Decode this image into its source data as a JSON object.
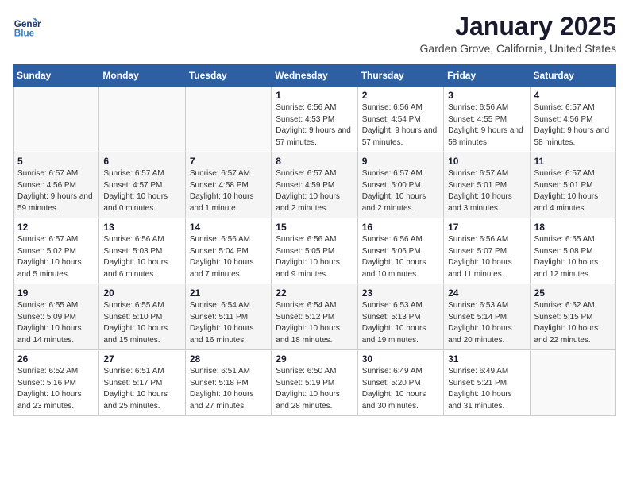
{
  "header": {
    "logo_line1": "General",
    "logo_line2": "Blue",
    "title": "January 2025",
    "subtitle": "Garden Grove, California, United States"
  },
  "weekdays": [
    "Sunday",
    "Monday",
    "Tuesday",
    "Wednesday",
    "Thursday",
    "Friday",
    "Saturday"
  ],
  "weeks": [
    [
      {
        "day": "",
        "sunrise": "",
        "sunset": "",
        "daylight": ""
      },
      {
        "day": "",
        "sunrise": "",
        "sunset": "",
        "daylight": ""
      },
      {
        "day": "",
        "sunrise": "",
        "sunset": "",
        "daylight": ""
      },
      {
        "day": "1",
        "sunrise": "Sunrise: 6:56 AM",
        "sunset": "Sunset: 4:53 PM",
        "daylight": "Daylight: 9 hours and 57 minutes."
      },
      {
        "day": "2",
        "sunrise": "Sunrise: 6:56 AM",
        "sunset": "Sunset: 4:54 PM",
        "daylight": "Daylight: 9 hours and 57 minutes."
      },
      {
        "day": "3",
        "sunrise": "Sunrise: 6:56 AM",
        "sunset": "Sunset: 4:55 PM",
        "daylight": "Daylight: 9 hours and 58 minutes."
      },
      {
        "day": "4",
        "sunrise": "Sunrise: 6:57 AM",
        "sunset": "Sunset: 4:56 PM",
        "daylight": "Daylight: 9 hours and 58 minutes."
      }
    ],
    [
      {
        "day": "5",
        "sunrise": "Sunrise: 6:57 AM",
        "sunset": "Sunset: 4:56 PM",
        "daylight": "Daylight: 9 hours and 59 minutes."
      },
      {
        "day": "6",
        "sunrise": "Sunrise: 6:57 AM",
        "sunset": "Sunset: 4:57 PM",
        "daylight": "Daylight: 10 hours and 0 minutes."
      },
      {
        "day": "7",
        "sunrise": "Sunrise: 6:57 AM",
        "sunset": "Sunset: 4:58 PM",
        "daylight": "Daylight: 10 hours and 1 minute."
      },
      {
        "day": "8",
        "sunrise": "Sunrise: 6:57 AM",
        "sunset": "Sunset: 4:59 PM",
        "daylight": "Daylight: 10 hours and 2 minutes."
      },
      {
        "day": "9",
        "sunrise": "Sunrise: 6:57 AM",
        "sunset": "Sunset: 5:00 PM",
        "daylight": "Daylight: 10 hours and 2 minutes."
      },
      {
        "day": "10",
        "sunrise": "Sunrise: 6:57 AM",
        "sunset": "Sunset: 5:01 PM",
        "daylight": "Daylight: 10 hours and 3 minutes."
      },
      {
        "day": "11",
        "sunrise": "Sunrise: 6:57 AM",
        "sunset": "Sunset: 5:01 PM",
        "daylight": "Daylight: 10 hours and 4 minutes."
      }
    ],
    [
      {
        "day": "12",
        "sunrise": "Sunrise: 6:57 AM",
        "sunset": "Sunset: 5:02 PM",
        "daylight": "Daylight: 10 hours and 5 minutes."
      },
      {
        "day": "13",
        "sunrise": "Sunrise: 6:56 AM",
        "sunset": "Sunset: 5:03 PM",
        "daylight": "Daylight: 10 hours and 6 minutes."
      },
      {
        "day": "14",
        "sunrise": "Sunrise: 6:56 AM",
        "sunset": "Sunset: 5:04 PM",
        "daylight": "Daylight: 10 hours and 7 minutes."
      },
      {
        "day": "15",
        "sunrise": "Sunrise: 6:56 AM",
        "sunset": "Sunset: 5:05 PM",
        "daylight": "Daylight: 10 hours and 9 minutes."
      },
      {
        "day": "16",
        "sunrise": "Sunrise: 6:56 AM",
        "sunset": "Sunset: 5:06 PM",
        "daylight": "Daylight: 10 hours and 10 minutes."
      },
      {
        "day": "17",
        "sunrise": "Sunrise: 6:56 AM",
        "sunset": "Sunset: 5:07 PM",
        "daylight": "Daylight: 10 hours and 11 minutes."
      },
      {
        "day": "18",
        "sunrise": "Sunrise: 6:55 AM",
        "sunset": "Sunset: 5:08 PM",
        "daylight": "Daylight: 10 hours and 12 minutes."
      }
    ],
    [
      {
        "day": "19",
        "sunrise": "Sunrise: 6:55 AM",
        "sunset": "Sunset: 5:09 PM",
        "daylight": "Daylight: 10 hours and 14 minutes."
      },
      {
        "day": "20",
        "sunrise": "Sunrise: 6:55 AM",
        "sunset": "Sunset: 5:10 PM",
        "daylight": "Daylight: 10 hours and 15 minutes."
      },
      {
        "day": "21",
        "sunrise": "Sunrise: 6:54 AM",
        "sunset": "Sunset: 5:11 PM",
        "daylight": "Daylight: 10 hours and 16 minutes."
      },
      {
        "day": "22",
        "sunrise": "Sunrise: 6:54 AM",
        "sunset": "Sunset: 5:12 PM",
        "daylight": "Daylight: 10 hours and 18 minutes."
      },
      {
        "day": "23",
        "sunrise": "Sunrise: 6:53 AM",
        "sunset": "Sunset: 5:13 PM",
        "daylight": "Daylight: 10 hours and 19 minutes."
      },
      {
        "day": "24",
        "sunrise": "Sunrise: 6:53 AM",
        "sunset": "Sunset: 5:14 PM",
        "daylight": "Daylight: 10 hours and 20 minutes."
      },
      {
        "day": "25",
        "sunrise": "Sunrise: 6:52 AM",
        "sunset": "Sunset: 5:15 PM",
        "daylight": "Daylight: 10 hours and 22 minutes."
      }
    ],
    [
      {
        "day": "26",
        "sunrise": "Sunrise: 6:52 AM",
        "sunset": "Sunset: 5:16 PM",
        "daylight": "Daylight: 10 hours and 23 minutes."
      },
      {
        "day": "27",
        "sunrise": "Sunrise: 6:51 AM",
        "sunset": "Sunset: 5:17 PM",
        "daylight": "Daylight: 10 hours and 25 minutes."
      },
      {
        "day": "28",
        "sunrise": "Sunrise: 6:51 AM",
        "sunset": "Sunset: 5:18 PM",
        "daylight": "Daylight: 10 hours and 27 minutes."
      },
      {
        "day": "29",
        "sunrise": "Sunrise: 6:50 AM",
        "sunset": "Sunset: 5:19 PM",
        "daylight": "Daylight: 10 hours and 28 minutes."
      },
      {
        "day": "30",
        "sunrise": "Sunrise: 6:49 AM",
        "sunset": "Sunset: 5:20 PM",
        "daylight": "Daylight: 10 hours and 30 minutes."
      },
      {
        "day": "31",
        "sunrise": "Sunrise: 6:49 AM",
        "sunset": "Sunset: 5:21 PM",
        "daylight": "Daylight: 10 hours and 31 minutes."
      },
      {
        "day": "",
        "sunrise": "",
        "sunset": "",
        "daylight": ""
      }
    ]
  ]
}
